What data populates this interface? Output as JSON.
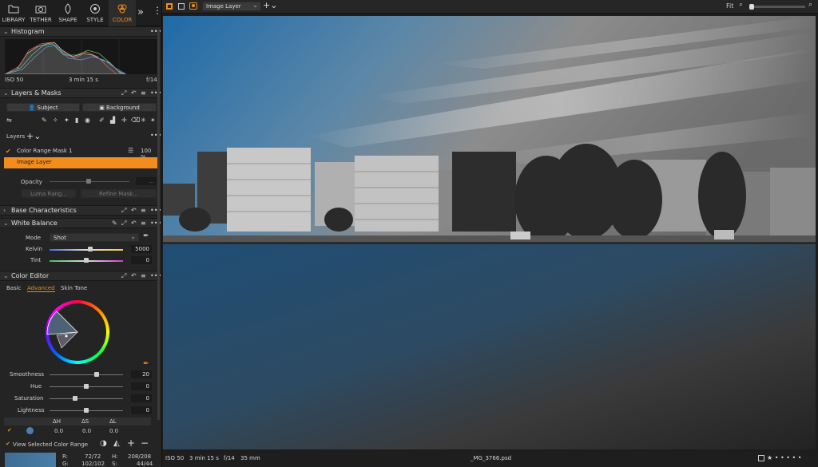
{
  "tabs": [
    {
      "label": "LIBRARY",
      "icon": "folder-icon"
    },
    {
      "label": "TETHER",
      "icon": "camera-icon"
    },
    {
      "label": "SHAPE",
      "icon": "shape-icon"
    },
    {
      "label": "STYLE",
      "icon": "style-icon"
    },
    {
      "label": "COLOR",
      "icon": "color-icon",
      "active": true
    }
  ],
  "histogram": {
    "title": "Histogram",
    "iso": "ISO 50",
    "exposure": "3 min 15 s",
    "aperture": "f/14"
  },
  "layers": {
    "title": "Layers & Masks",
    "subject_label": "Subject",
    "background_label": "Background",
    "layers_label": "Layers",
    "mask_name": "Color Range Mask 1",
    "mask_opacity": "100 %",
    "image_layer": "Image Layer",
    "opacity_label": "Opacity",
    "luma_range": "Luma Rang...",
    "refine_mask": "Refine Mask..."
  },
  "base": {
    "title": "Base Characteristics"
  },
  "wb": {
    "title": "White Balance",
    "mode_label": "Mode",
    "mode_value": "Shot",
    "kelvin_label": "Kelvin",
    "kelvin_value": "5000",
    "tint_label": "Tint",
    "tint_value": "0"
  },
  "color_editor": {
    "title": "Color Editor",
    "tabs": [
      "Basic",
      "Advanced",
      "Skin Tone"
    ],
    "smoothness_label": "Smoothness",
    "smoothness_value": "20",
    "hue_label": "Hue",
    "hue_value": "0",
    "saturation_label": "Saturation",
    "saturation_value": "0",
    "lightness_label": "Lightness",
    "lightness_value": "0",
    "dH": "ΔH",
    "dS": "ΔS",
    "dL": "ΔL",
    "dH_val": "0.0",
    "dS_val": "0.0",
    "dL_val": "0.0",
    "view_selected": "View Selected Color Range",
    "r_label": "R:",
    "r_val": "72/72",
    "g_label": "G:",
    "g_val": "102/102",
    "h_label": "H:",
    "h_val": "208/208",
    "s_label": "S:",
    "s_val": "44/44"
  },
  "topbar": {
    "layer_select": "Image Layer",
    "fit_label": "Fit"
  },
  "statusbar": {
    "iso": "ISO 50",
    "exposure": "3 min 15 s",
    "aperture": "f/14",
    "focal": "35 mm",
    "filename": "_MG_3766.psd",
    "stars": "★ • • • • •"
  },
  "colors": {
    "accent": "#f28c1c",
    "panel": "#242424",
    "viewer": "#1d1d1d"
  }
}
